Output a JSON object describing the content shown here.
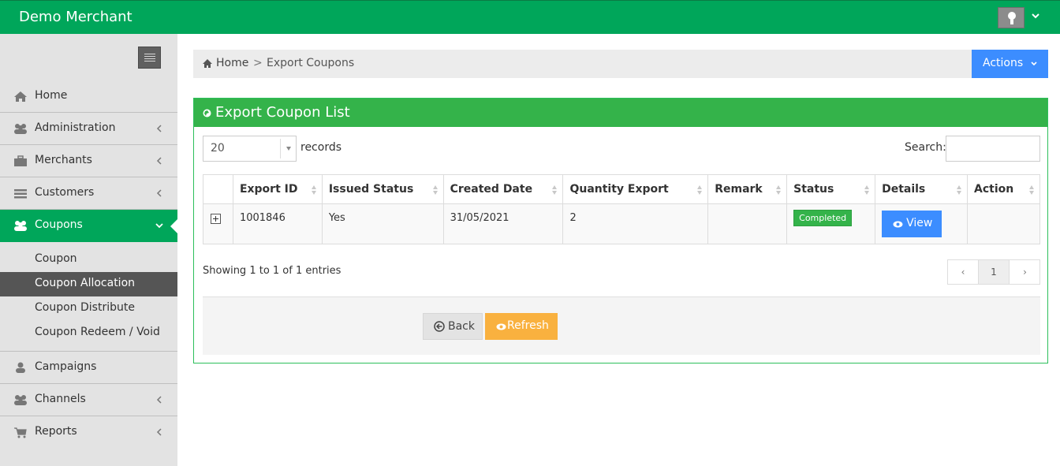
{
  "app": {
    "brand": "Demo Merchant"
  },
  "sidebar": {
    "items": [
      {
        "label": "Home",
        "icon": "home-icon",
        "has_chevron": false
      },
      {
        "label": "Administration",
        "icon": "users-icon",
        "has_chevron": true
      },
      {
        "label": "Merchants",
        "icon": "briefcase-icon",
        "has_chevron": true
      },
      {
        "label": "Customers",
        "icon": "list-icon",
        "has_chevron": true
      },
      {
        "label": "Coupons",
        "icon": "users-icon",
        "has_chevron": true,
        "active": true
      },
      {
        "label": "Campaigns",
        "icon": "user-icon",
        "has_chevron": false
      },
      {
        "label": "Channels",
        "icon": "users-icon",
        "has_chevron": true
      },
      {
        "label": "Reports",
        "icon": "cart-icon",
        "has_chevron": true
      }
    ],
    "coupon_sub": [
      "Coupon",
      "Coupon Allocation",
      "Coupon Distribute",
      "Coupon Redeem / Void"
    ],
    "current_sub": "Coupon Allocation"
  },
  "breadcrumb": {
    "home": "Home",
    "separator": ">",
    "current": "Export Coupons"
  },
  "actions_label": "Actions",
  "panel": {
    "title": "Export Coupon List",
    "length_value": "20",
    "length_label": "records",
    "search_label": "Search:",
    "search_value": ""
  },
  "table": {
    "columns": [
      "Export ID",
      "Issued Status",
      "Created Date",
      "Quantity Export",
      "Remark",
      "Status",
      "Details",
      "Action"
    ],
    "rows": [
      {
        "export_id": "1001846",
        "issued_status": "Yes",
        "created_date": "31/05/2021",
        "quantity_export": "2",
        "remark": "",
        "status": "Completed",
        "details_label": "View",
        "action": ""
      }
    ]
  },
  "info": "Showing 1 to 1 of 1 entries",
  "pagination": {
    "prev": "‹",
    "current": "1",
    "next": "›"
  },
  "buttons": {
    "back": "Back",
    "refresh": "Refresh"
  },
  "colors": {
    "brand_green": "#00a65a",
    "panel_green": "#34b34a",
    "primary_blue": "#3c8dff",
    "warning_orange": "#f9b13f"
  }
}
